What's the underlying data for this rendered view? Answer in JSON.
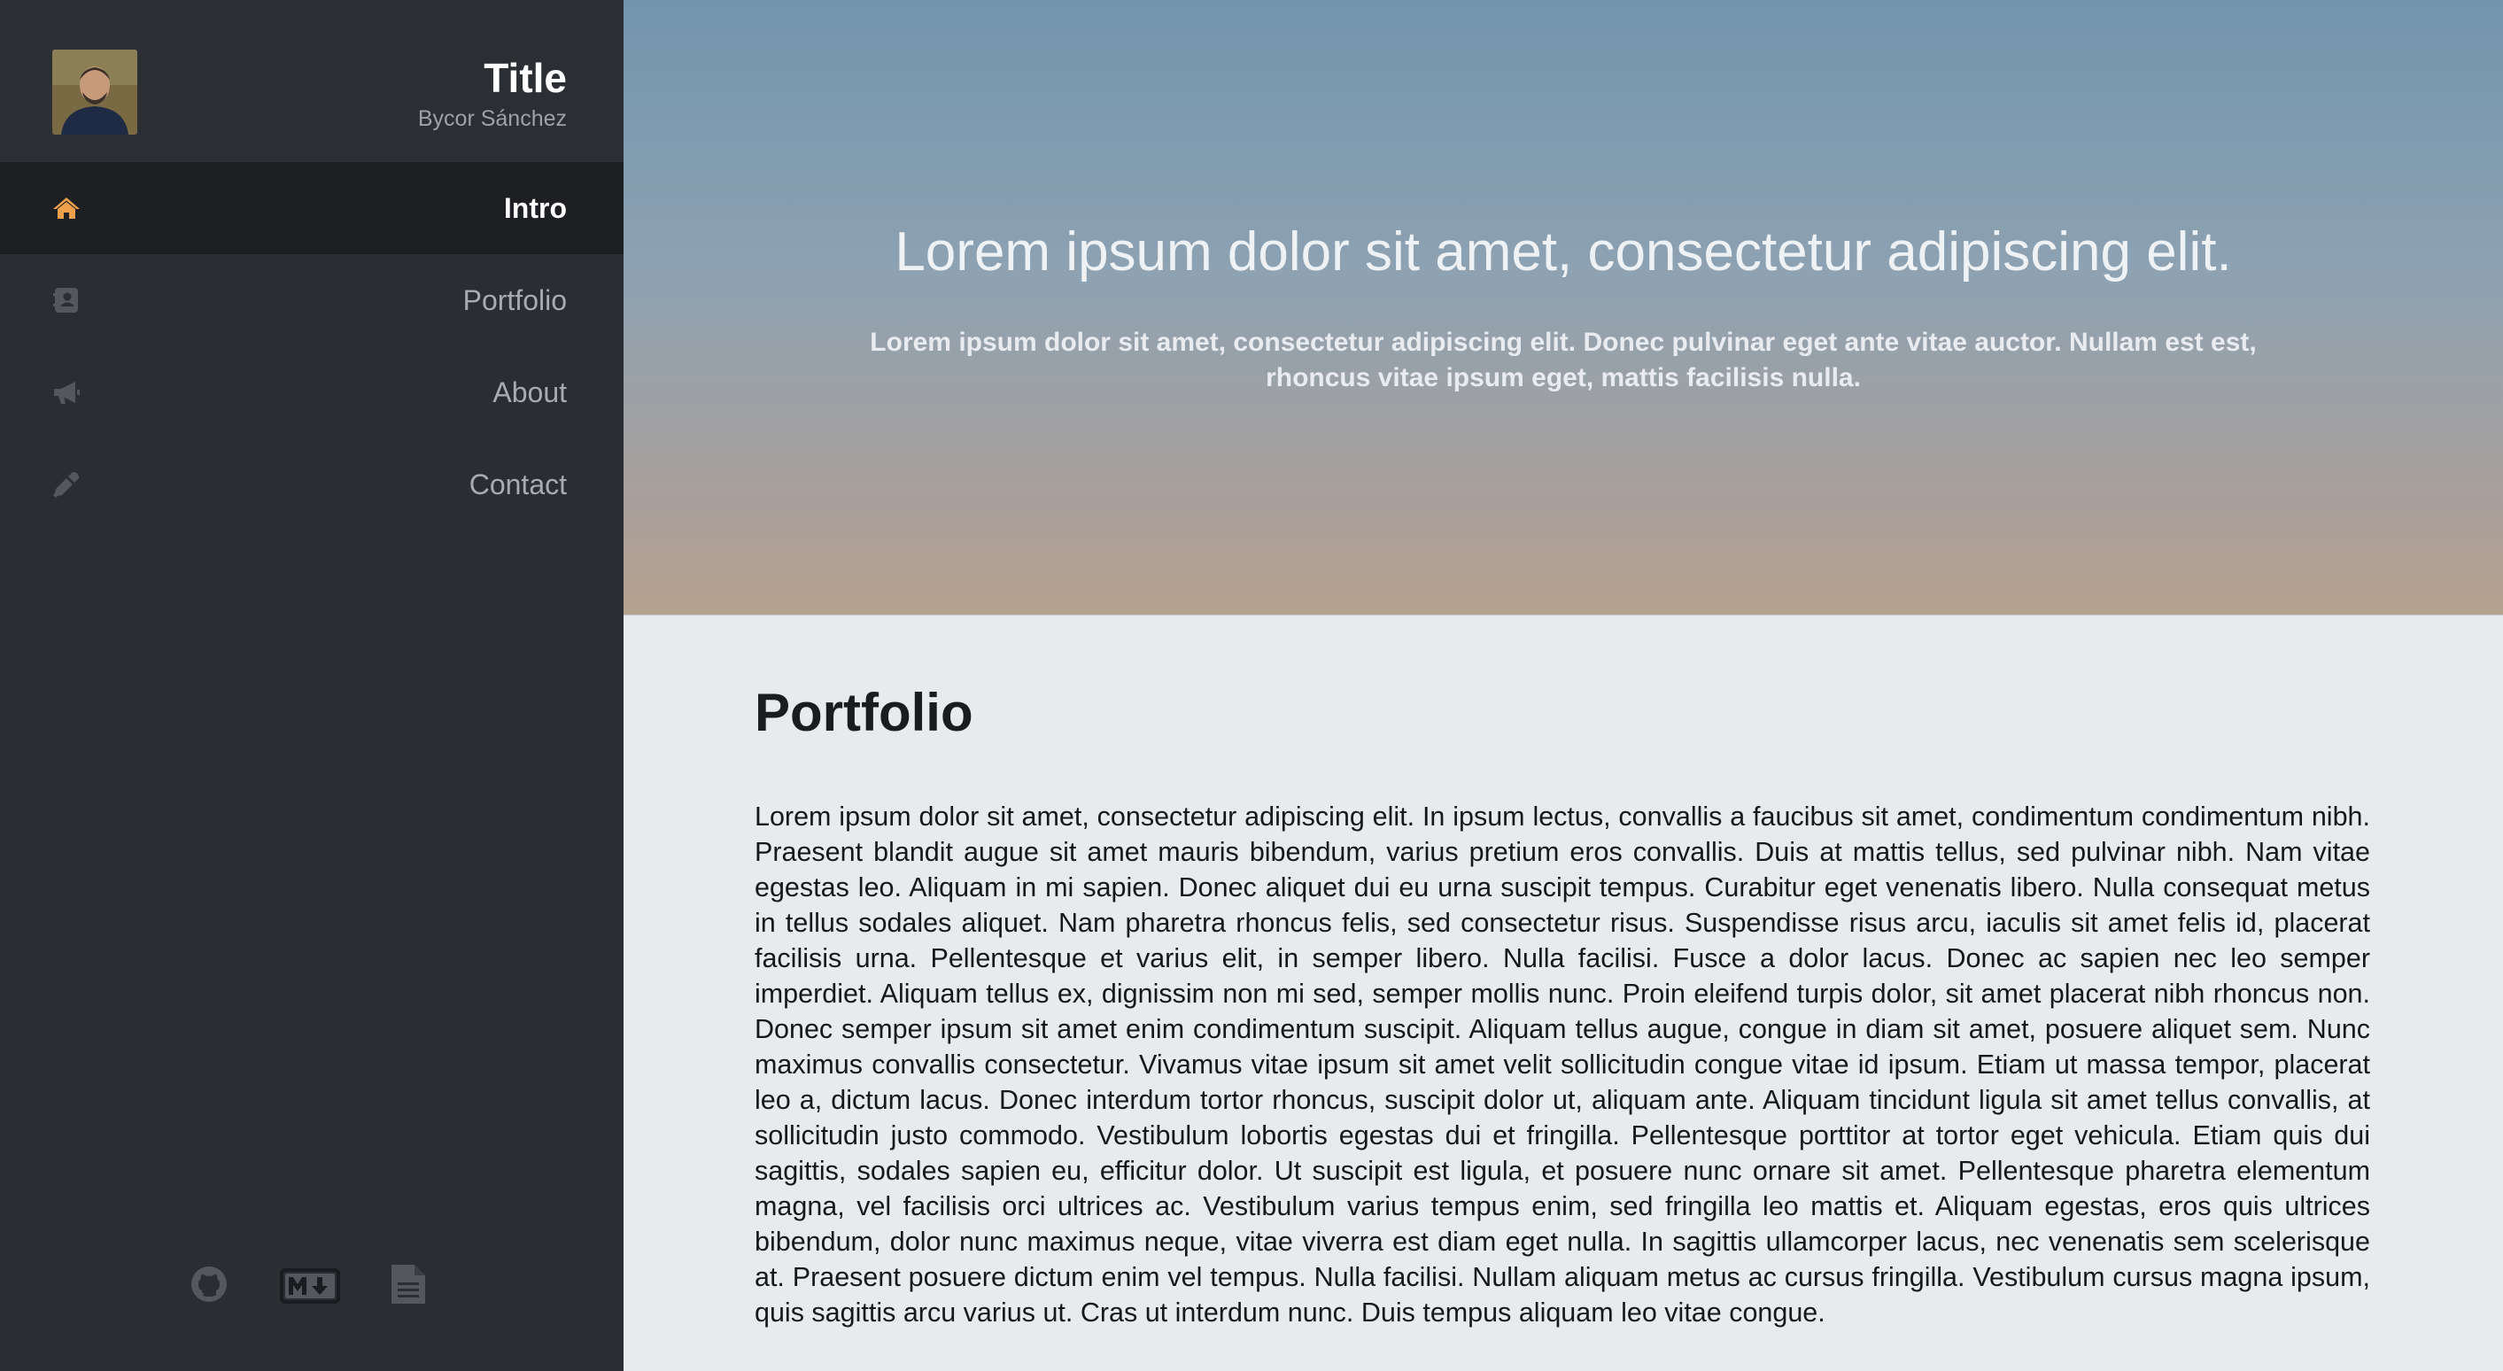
{
  "sidebar": {
    "title": "Title",
    "subtitle": "Bycor Sánchez",
    "avatar_alt": "profile photo",
    "nav": [
      {
        "label": "Intro",
        "icon": "home-icon",
        "active": true
      },
      {
        "label": "Portfolio",
        "icon": "contact-book-icon",
        "active": false
      },
      {
        "label": "About",
        "icon": "megaphone-icon",
        "active": false
      },
      {
        "label": "Contact",
        "icon": "eyedropper-icon",
        "active": false
      }
    ],
    "footer_icons": [
      "github-icon",
      "markdown-icon",
      "document-icon"
    ]
  },
  "hero": {
    "title": "Lorem ipsum dolor sit amet, consectetur adipiscing elit.",
    "text": "Lorem ipsum dolor sit amet, consectetur adipiscing elit. Donec pulvinar eget ante vitae auctor. Nullam est est, rhoncus vitae ipsum eget, mattis facilisis nulla."
  },
  "portfolio": {
    "title": "Portfolio",
    "body": "Lorem ipsum dolor sit amet, consectetur adipiscing elit. In ipsum lectus, convallis a faucibus sit amet, condimentum condimentum nibh. Praesent blandit augue sit amet mauris bibendum, varius pretium eros convallis. Duis at mattis tellus, sed pulvinar nibh. Nam vitae egestas leo. Aliquam in mi sapien. Donec aliquet dui eu urna suscipit tempus. Curabitur eget venenatis libero. Nulla consequat metus in tellus sodales aliquet. Nam pharetra rhoncus felis, sed consectetur risus. Suspendisse risus arcu, iaculis sit amet felis id, placerat facilisis urna. Pellentesque et varius elit, in semper libero. Nulla facilisi. Fusce a dolor lacus. Donec ac sapien nec leo semper imperdiet. Aliquam tellus ex, dignissim non mi sed, semper mollis nunc. Proin eleifend turpis dolor, sit amet placerat nibh rhoncus non. Donec semper ipsum sit amet enim condimentum suscipit. Aliquam tellus augue, congue in diam sit amet, posuere aliquet sem. Nunc maximus convallis consectetur. Vivamus vitae ipsum sit amet velit sollicitudin congue vitae id ipsum. Etiam ut massa tempor, placerat leo a, dictum lacus. Donec interdum tortor rhoncus, suscipit dolor ut, aliquam ante. Aliquam tincidunt ligula sit amet tellus convallis, at sollicitudin justo commodo. Vestibulum lobortis egestas dui et fringilla. Pellentesque porttitor at tortor eget vehicula. Etiam quis dui sagittis, sodales sapien eu, efficitur dolor. Ut suscipit est ligula, et posuere nunc ornare sit amet. Pellentesque pharetra elementum magna, vel facilisis orci ultrices ac. Vestibulum varius tempus enim, sed fringilla leo mattis et. Aliquam egestas, eros quis ultrices bibendum, dolor nunc maximus neque, vitae viverra est diam eget nulla. In sagittis ullamcorper lacus, nec venenatis sem scelerisque at. Praesent posuere dictum enim vel tempus. Nulla facilisi. Nullam aliquam metus ac cursus fringilla. Vestibulum cursus magna ipsum, quis sagittis arcu varius ut. Cras ut interdum nunc. Duis tempus aliquam leo vitae congue."
  },
  "colors": {
    "sidebar_bg": "#2a2d31",
    "nav_active_bg": "#1d1f23",
    "home_icon": "#f0a04b",
    "muted_icon": "#54585e",
    "content_bg": "#e7ebee"
  }
}
